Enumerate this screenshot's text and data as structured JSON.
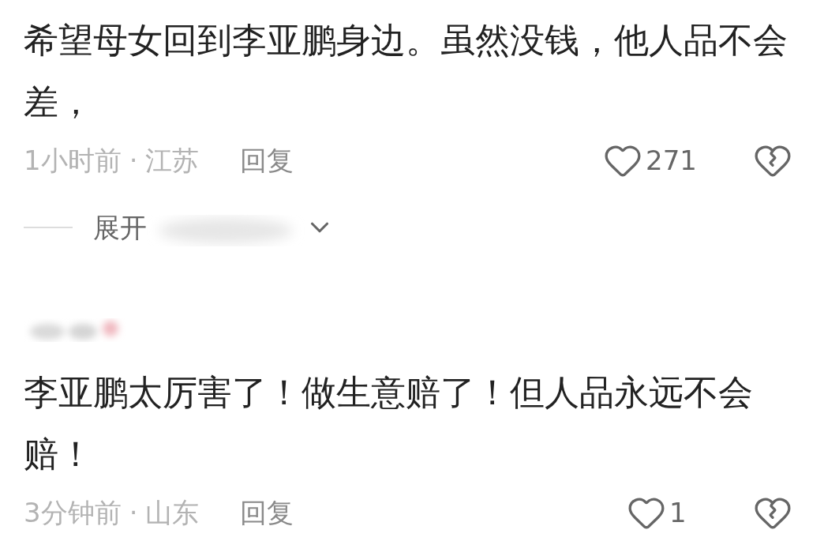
{
  "comments": [
    {
      "text": "希望母女回到李亚鹏身边。虽然没钱，他人品不会差，",
      "time": "1小时前",
      "separator": "·",
      "location": "江苏",
      "reply": "回复",
      "likes": "271",
      "expand": "展开"
    },
    {
      "text": "李亚鹏太厉害了！做生意赔了！但人品永远不会赔！",
      "time": "3分钟前",
      "separator": "·",
      "location": "山东",
      "reply": "回复",
      "likes": "1"
    }
  ]
}
